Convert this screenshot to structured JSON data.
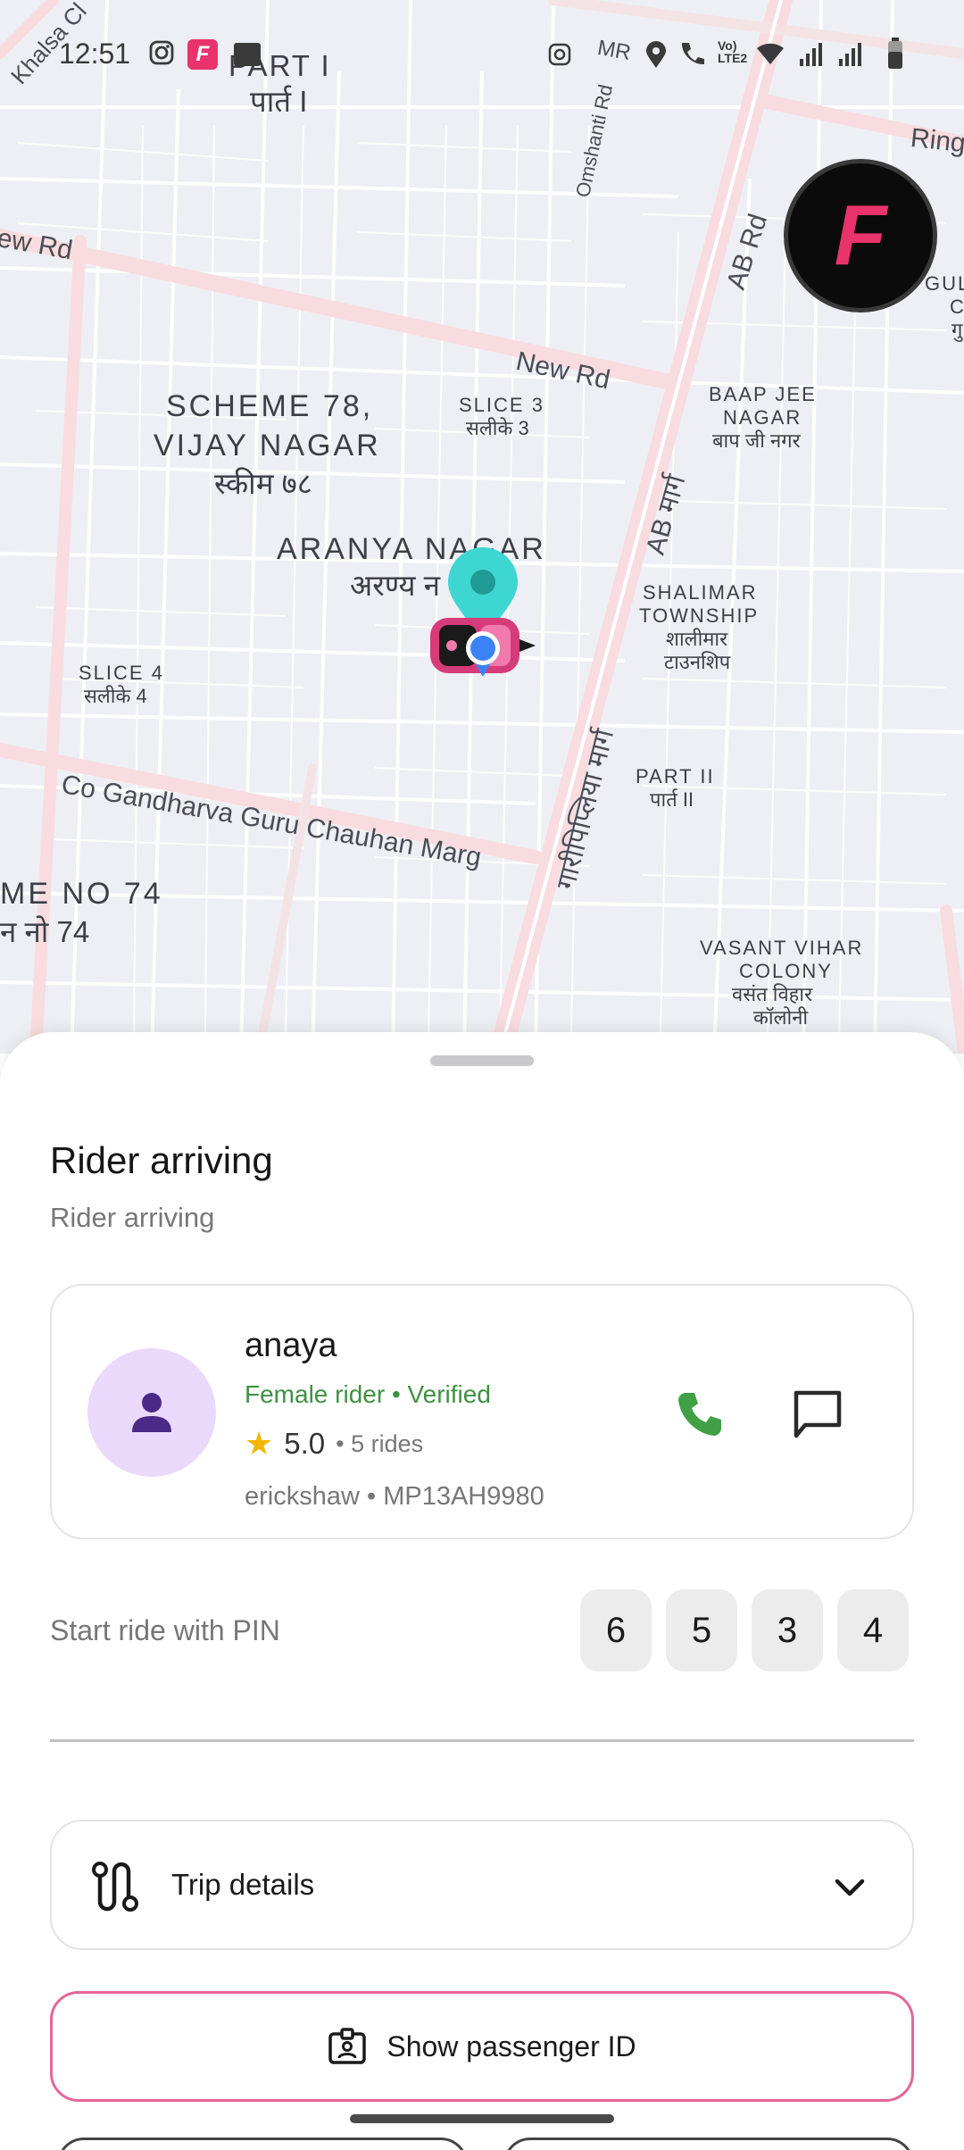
{
  "status_bar": {
    "time": "12:51",
    "icons": [
      "instagram-icon",
      "app-f-icon",
      "notification-icon",
      "location-icon",
      "wifi-call-icon",
      "volte-icon",
      "wifi-icon",
      "signal-icon",
      "signal-icon-2",
      "battery-icon"
    ]
  },
  "map": {
    "labels": {
      "part1_en": "PART I",
      "part1_hi": "पार्त I",
      "scheme78_1": "SCHEME 78,",
      "scheme78_2": "VIJAY NAGAR",
      "scheme78_hi": "स्कीम ७८",
      "slice3": "SLICE 3",
      "slice3_hi": "सलीके 3",
      "baapjee_1": "BAAP JEE",
      "baapjee_2": "NAGAR",
      "baapjee_hi": "बाप जी नगर",
      "aranya": "ARANYA NAGAR",
      "aranya_hi": "अरण्य न",
      "shalimar_1": "SHALIMAR",
      "shalimar_2": "TOWNSHIP",
      "shalimar_hi1": "शालीमार",
      "shalimar_hi2": "टाउनशिप",
      "slice4": "SLICE 4",
      "slice4_hi": "सलीके 4",
      "part2": "PART II",
      "part2_hi": "पार्त II",
      "scheme74": "ME NO 74",
      "scheme74_hi": "न नो 74",
      "vasant_1": "VASANT VIHAR",
      "vasant_2": "COLONY",
      "vasant_hi1": "वसंत विहार",
      "vasant_hi2": "कॉलोनी",
      "gul": "GUL",
      "gul2": "C",
      "gul3": "गु"
    },
    "roads": {
      "khalsa": "Khalsa Cl",
      "ew_rd": "ew Rd",
      "new_rd": "New Rd",
      "omshanti": "Omshanti Rd",
      "ab_rd": "AB Rd",
      "ab_marg": "AB मार्ग",
      "ring": "Ring",
      "gandharva": "Co Gandharva Guru Chauhan Marg",
      "garipipliya": "गारीपिप्लिया मार्ग",
      "mr": "MR"
    }
  },
  "sheet": {
    "title": "Rider arriving",
    "subtitle": "Rider arriving",
    "rider": {
      "name": "anaya",
      "status": "Female rider • Verified",
      "rating": "5.0",
      "rides": "• 5 rides",
      "vehicle": "erickshaw • MP13AH9980"
    },
    "pin": {
      "label": "Start ride with PIN",
      "digits": [
        "6",
        "5",
        "3",
        "4"
      ]
    },
    "trip_details_label": "Trip details",
    "passenger_id_label": "Show passenger ID"
  },
  "colors": {
    "accent_green": "#3f9142",
    "accent_pink": "#e4669a",
    "brand_pink": "#e8336d",
    "avatar_bg": "#ead9fb",
    "avatar_fg": "#4a2a86",
    "star": "#f3b700",
    "pin_marker": "#3ed6d0",
    "location_dot": "#3b82f6"
  }
}
